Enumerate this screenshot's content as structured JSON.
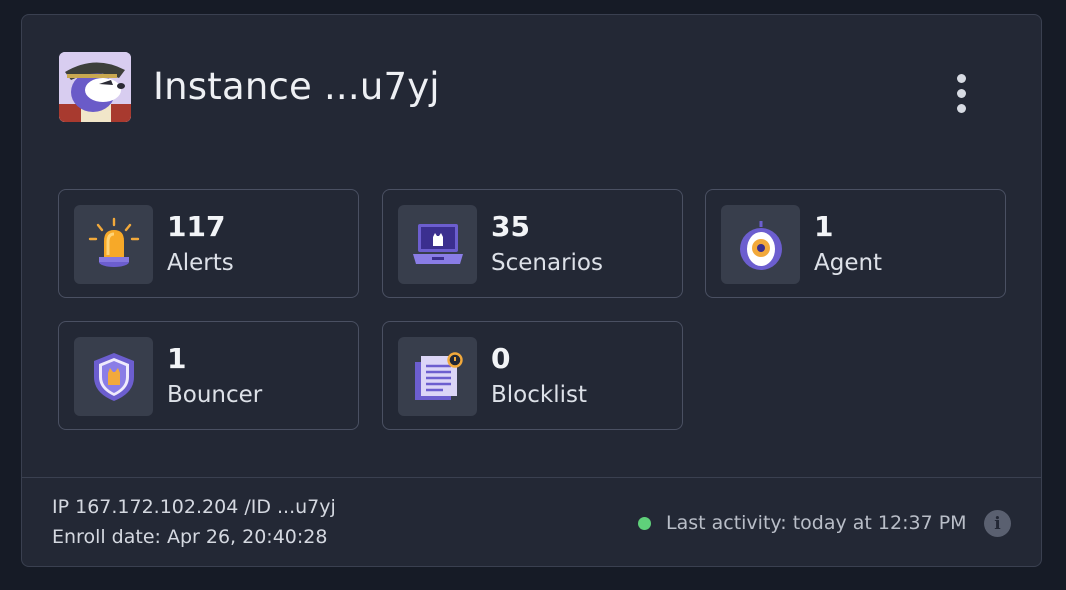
{
  "instance": {
    "title": "Instance ...u7yj",
    "avatar": "pirate-dog-avatar",
    "menu_icon": "vertical-dots-icon"
  },
  "stats": [
    {
      "value": "117",
      "label": "Alerts",
      "icon": "alarm-light-icon"
    },
    {
      "value": "35",
      "label": "Scenarios",
      "icon": "laptop-icon"
    },
    {
      "value": "1",
      "label": "Agent",
      "icon": "agent-eye-icon"
    },
    {
      "value": "1",
      "label": "Bouncer",
      "icon": "shield-icon"
    },
    {
      "value": "0",
      "label": "Blocklist",
      "icon": "document-list-icon"
    }
  ],
  "footer": {
    "ip_line": "IP 167.172.102.204 /ID ...u7yj",
    "enroll_line": "Enroll date: Apr 26, 20:40:28",
    "last_activity": "Last activity: today at 12:37 PM",
    "status_color": "#5fd07a"
  },
  "colors": {
    "background": "#161b26",
    "card": "#232835",
    "accent_purple": "#6c5ecf",
    "accent_orange": "#f2a93b"
  }
}
